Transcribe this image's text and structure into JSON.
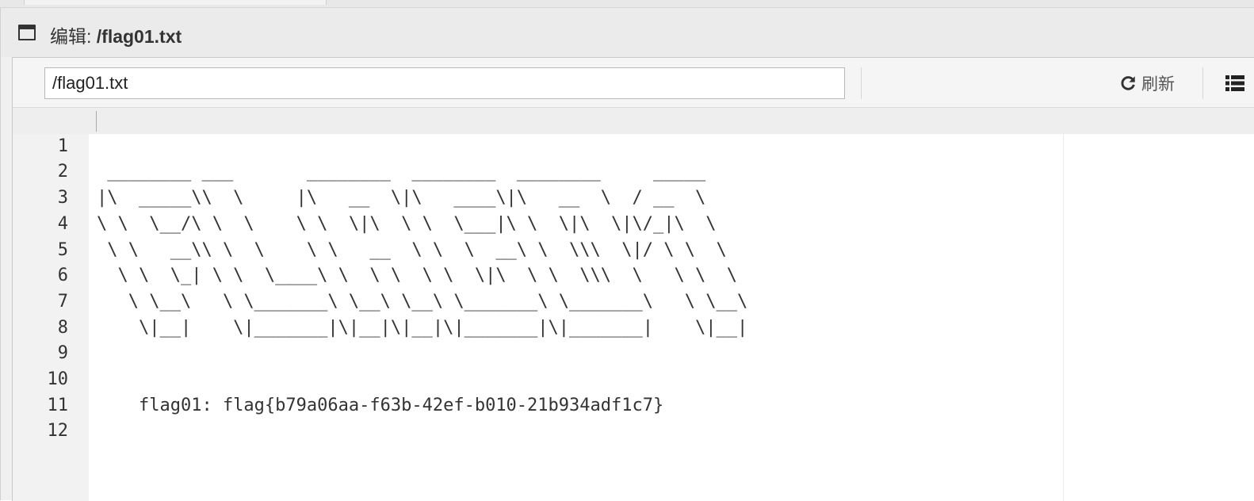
{
  "dialog": {
    "title_prefix": "编辑: ",
    "title_path": "/flag01.txt"
  },
  "toolbar": {
    "path_value": "/flag01.txt",
    "refresh_label": "刷新",
    "icons": {
      "refresh": "refresh-icon",
      "menu": "list-icon"
    }
  },
  "editor": {
    "lines": [
      {
        "num": "1",
        "text": " ________ ___       ________  ________  ________     _____"
      },
      {
        "num": "2",
        "text": "|\\  _____\\\\  \\     |\\   __  \\|\\   ____\\|\\   __  \\  / __  \\"
      },
      {
        "num": "3",
        "text": "\\ \\  \\__/\\ \\  \\    \\ \\  \\|\\  \\ \\  \\___|\\ \\  \\|\\  \\|\\/_|\\  \\"
      },
      {
        "num": "4",
        "text": " \\ \\   __\\\\ \\  \\    \\ \\   __  \\ \\  \\  __\\ \\  \\\\\\  \\|/ \\ \\  \\"
      },
      {
        "num": "5",
        "text": "  \\ \\  \\_| \\ \\  \\____\\ \\  \\ \\  \\ \\  \\|\\  \\ \\  \\\\\\  \\   \\ \\  \\"
      },
      {
        "num": "6",
        "text": "   \\ \\__\\   \\ \\_______\\ \\__\\ \\__\\ \\_______\\ \\_______\\   \\ \\__\\"
      },
      {
        "num": "7",
        "text": "    \\|__|    \\|_______|\\|__|\\|__|\\|_______|\\|_______|    \\|__|"
      },
      {
        "num": "8",
        "text": ""
      },
      {
        "num": "9",
        "text": ""
      },
      {
        "num": "10",
        "text": "    flag01: flag{b79a06aa-f63b-42ef-b010-21b934adf1c7}"
      },
      {
        "num": "11",
        "text": ""
      },
      {
        "num": "12",
        "text": ""
      }
    ]
  }
}
